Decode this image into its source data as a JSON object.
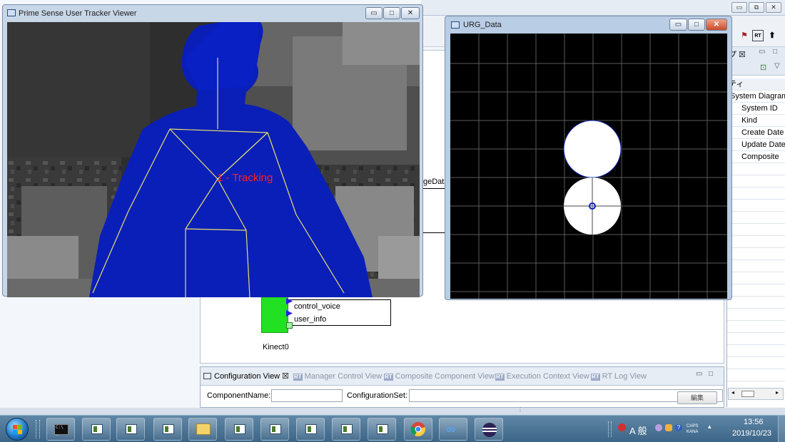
{
  "tracker_window": {
    "title": "Prime Sense User Tracker Viewer",
    "tracking_label": "1 - Tracking",
    "buttons": {
      "minimize": "▭",
      "maximize": "□",
      "close": "✕"
    }
  },
  "urg_window": {
    "title": "URG_Data",
    "buttons": {
      "minimize": "▭",
      "maximize": "□",
      "close": "✕"
    }
  },
  "workbench": {
    "window_buttons": {
      "minimize": "▭",
      "restore": "⧉",
      "close": "✕"
    },
    "toolbar_icon_labels": {
      "rt_button": "RT"
    },
    "properties": {
      "tab_label": "プ ☒",
      "header_cell": "ティ",
      "rows": [
        "System Diagram",
        "System ID",
        "Kind",
        "Create Date",
        "Update Date",
        "Composite"
      ]
    },
    "editor": {
      "partial_port_label": "geData",
      "ports": [
        "control_voice",
        "user_info"
      ],
      "component_name": "Kinect0"
    },
    "config_view": {
      "tabs": [
        {
          "label": "Configuration View ☒",
          "icon": "table-icon"
        },
        {
          "label": "Manager Control View",
          "icon": "rt-icon"
        },
        {
          "label": "Composite Component View",
          "icon": "rt-icon"
        },
        {
          "label": "Execution Context View",
          "icon": "rt-icon"
        },
        {
          "label": "RT Log View",
          "icon": "rt-icon"
        }
      ],
      "rt_badge": "RT",
      "component_name_label": "ComponentName:",
      "configuration_set_label": "ConfigurationSet:",
      "edit_button": "編集",
      "view_buttons": {
        "minimize": "▭",
        "maximize": "□"
      }
    }
  },
  "taskbar": {
    "clock_time": "13:56",
    "clock_date": "2019/10/23",
    "ime_text": "A 般",
    "caps_label": "CAPS",
    "kana_label": "KANA",
    "tray_arrow": "▴"
  },
  "colors": {
    "body_blue": "#0a1fb8",
    "skeleton": "#e8e070",
    "tracking_text": "#ff2020",
    "urg_grid": "#5a5a5a",
    "component_green": "#22e022"
  }
}
